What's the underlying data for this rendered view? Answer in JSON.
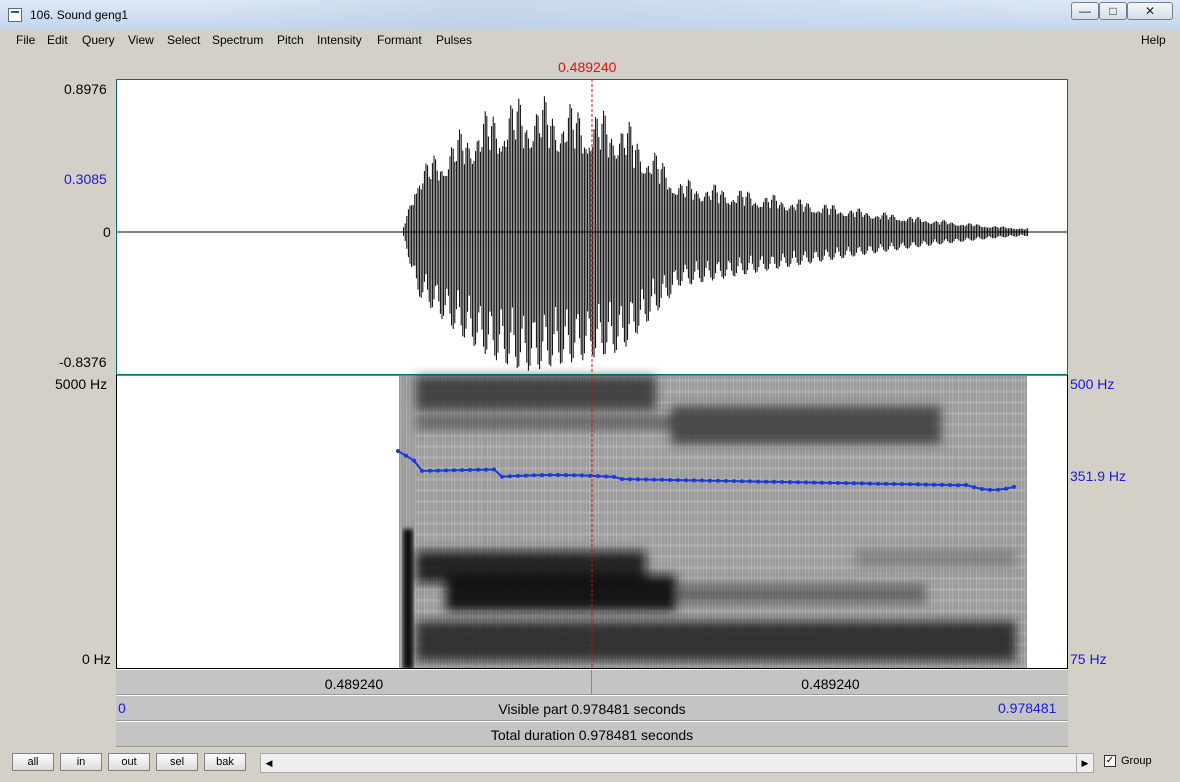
{
  "window": {
    "title": "106. Sound geng1"
  },
  "menu": {
    "items": [
      "File",
      "Edit",
      "Query",
      "View",
      "Select",
      "Spectrum",
      "Pitch",
      "Intensity",
      "Formant",
      "Pulses"
    ],
    "help": "Help"
  },
  "cursor": {
    "time_label": "0.489240"
  },
  "waveform": {
    "max_label": "0.8976",
    "mid_label": "0.3085",
    "zero_label": "0",
    "min_label": "-0.8376"
  },
  "spectrogram": {
    "top_freq": "5000 Hz",
    "bottom_freq": "0 Hz"
  },
  "pitch": {
    "top": "500 Hz",
    "current": "351.9 Hz",
    "bottom": "75 Hz"
  },
  "timebar": {
    "left_segment": "0.489240",
    "right_segment": "0.489240"
  },
  "visible_bar": {
    "start": "0",
    "text": "Visible part 0.978481 seconds",
    "end": "0.978481"
  },
  "total_bar": {
    "text": "Total duration 0.978481 seconds"
  },
  "buttons": {
    "all": "all",
    "in": "in",
    "out": "out",
    "sel": "sel",
    "bak": "bak"
  },
  "group": {
    "label": "Group",
    "checked": true
  },
  "colors": {
    "cursor": "#d11111",
    "pitch": "#1a3ad6",
    "axis_blue": "#1a1ad6"
  }
}
